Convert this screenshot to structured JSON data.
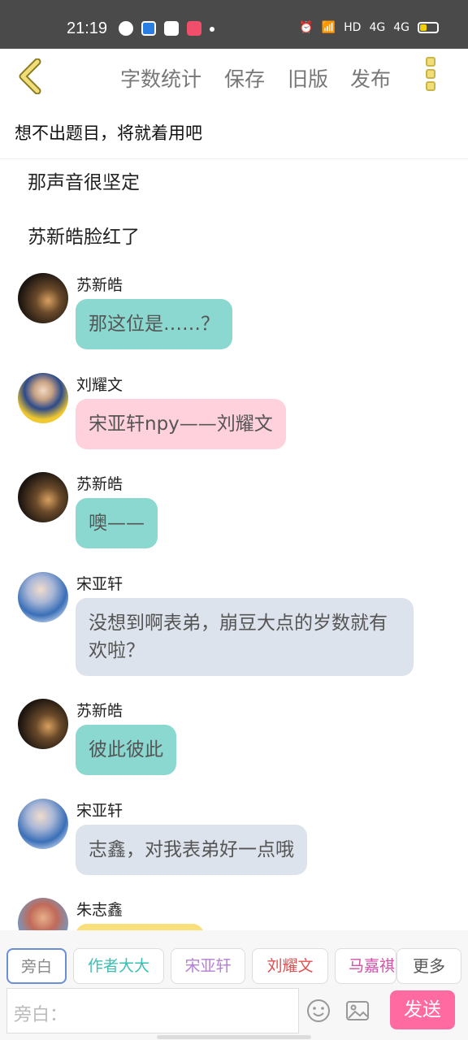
{
  "status_bar": {
    "time": "21:19",
    "network_label": "HD",
    "signal_label": "4G"
  },
  "toolbar": {
    "word_count": "字数统计",
    "save": "保存",
    "old_version": "旧版",
    "publish": "发布"
  },
  "story_title": "想不出题目，将就着用吧",
  "narration": [
    "那声音很坚定",
    "苏新皓脸红了"
  ],
  "messages": [
    {
      "name": "苏新皓",
      "text": "那这位是……？",
      "color": "#8bd8d0"
    },
    {
      "name": "刘耀文",
      "text": "宋亚轩npy——刘耀文",
      "color": "#ffd1dc"
    },
    {
      "name": "苏新皓",
      "text": "噢——",
      "color": "#8bd8d0"
    },
    {
      "name": "宋亚轩",
      "text": "没想到啊表弟，崩豆大点的岁数就有欢啦？",
      "color": "#dde3ec"
    },
    {
      "name": "苏新皓",
      "text": "彼此彼此",
      "color": "#8bd8d0"
    },
    {
      "name": "宋亚轩",
      "text": "志鑫，对我表弟好一点哦",
      "color": "#dde3ec"
    },
    {
      "name": "朱志鑫",
      "text": "",
      "color": "#f9e07a"
    }
  ],
  "characters": [
    {
      "label": "旁白",
      "color": "#888888"
    },
    {
      "label": "作者大大",
      "color": "#3bbfb3"
    },
    {
      "label": "宋亚轩",
      "color": "#b57fd6"
    },
    {
      "label": "刘耀文",
      "color": "#e05050"
    },
    {
      "label": "马嘉祺",
      "color": "#d34fa8"
    },
    {
      "label": "更多",
      "color": "#555555"
    }
  ],
  "input": {
    "placeholder": "旁白："
  },
  "send_label": "发送",
  "colors": {
    "accent": "#ff6aa0",
    "back_arrow": "#c9b54a"
  }
}
